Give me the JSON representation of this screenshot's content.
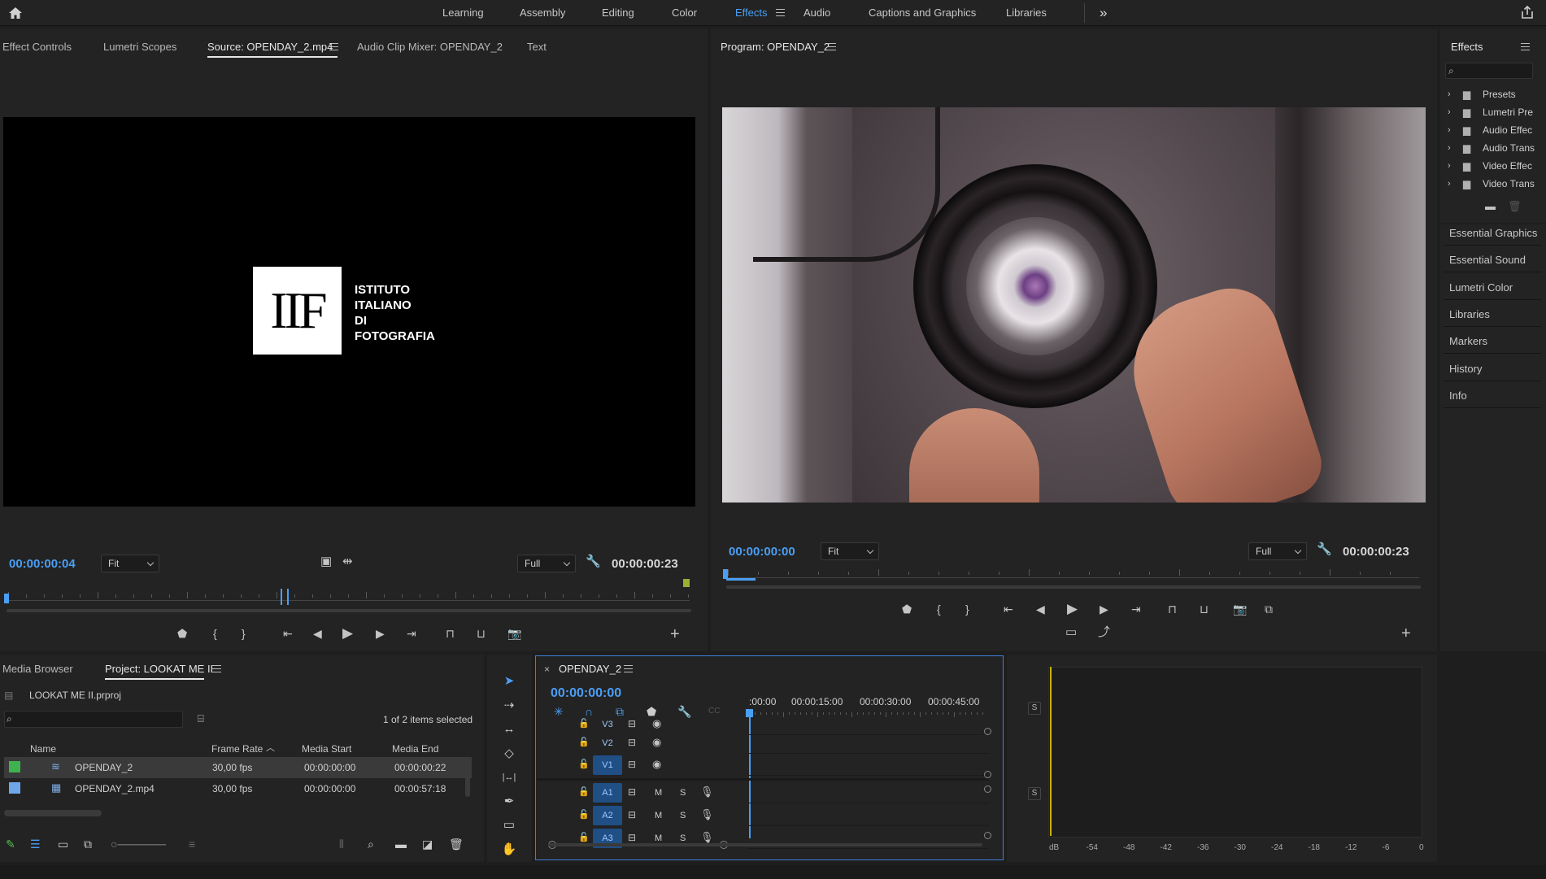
{
  "topbar": {
    "workspaces": [
      "Learning",
      "Assembly",
      "Editing",
      "Color",
      "Effects",
      "Audio",
      "Captions and Graphics",
      "Libraries"
    ],
    "active_workspace": "Effects",
    "more": "»"
  },
  "source_panel": {
    "tabs": [
      "Effect Controls",
      "Lumetri Scopes",
      "Source: OPENDAY_2.mp4",
      "Audio Clip Mixer: OPENDAY_2",
      "Text"
    ],
    "active_tab": "Source: OPENDAY_2.mp4",
    "timecode_in": "00:00:00:04",
    "zoom": "Fit",
    "resolution": "Full",
    "duration": "00:00:00:23",
    "playhead_fraction": 0.0,
    "logo": {
      "mark": "IIF",
      "lines": [
        "ISTITUTO",
        "ITALIANO",
        "DI",
        "FOTOGRAFIA"
      ]
    }
  },
  "program_panel": {
    "title": "Program: OPENDAY_2",
    "timecode_in": "00:00:00:00",
    "zoom": "Fit",
    "resolution": "Full",
    "duration": "00:00:00:23"
  },
  "effects_panel": {
    "title": "Effects",
    "folders": [
      "Presets",
      "Lumetri Pre",
      "Audio Effec",
      "Audio Trans",
      "Video Effec",
      "Video Trans"
    ],
    "menu": [
      "Essential Graphics",
      "Essential Sound",
      "Lumetri Color",
      "Libraries",
      "Markers",
      "History",
      "Info"
    ]
  },
  "project_panel": {
    "tabs": [
      "Media Browser",
      "Project: LOOKAT ME II"
    ],
    "active_tab": "Project: LOOKAT ME II",
    "file": "LOOKAT ME II.prproj",
    "selection": "1 of 2 items selected",
    "columns": [
      "Name",
      "Frame Rate",
      "Media Start",
      "Media End"
    ],
    "rows": [
      {
        "name": "OPENDAY_2",
        "rate": "30,00 fps",
        "start": "00:00:00:00",
        "end": "00:00:00:22",
        "color": "#3fb24f"
      },
      {
        "name": "OPENDAY_2.mp4",
        "rate": "30,00 fps",
        "start": "00:00:00:00",
        "end": "00:00:57:18",
        "color": "#6fa6e8"
      }
    ]
  },
  "timeline": {
    "sequence": "OPENDAY_2",
    "timecode": "00:00:00:00",
    "ruler": [
      ":00:00",
      "00:00:15:00",
      "00:00:30:00",
      "00:00:45:00"
    ],
    "video_tracks": [
      "V3",
      "V2",
      "V1"
    ],
    "audio_tracks": [
      "A1",
      "A2",
      "A3"
    ],
    "m": "M",
    "s": "S"
  },
  "audio_meter": {
    "scale": [
      "dB",
      "-54",
      "-48",
      "-42",
      "-36",
      "-30",
      "-24",
      "-18",
      "-12",
      "-6",
      "0"
    ],
    "solo": "S"
  }
}
